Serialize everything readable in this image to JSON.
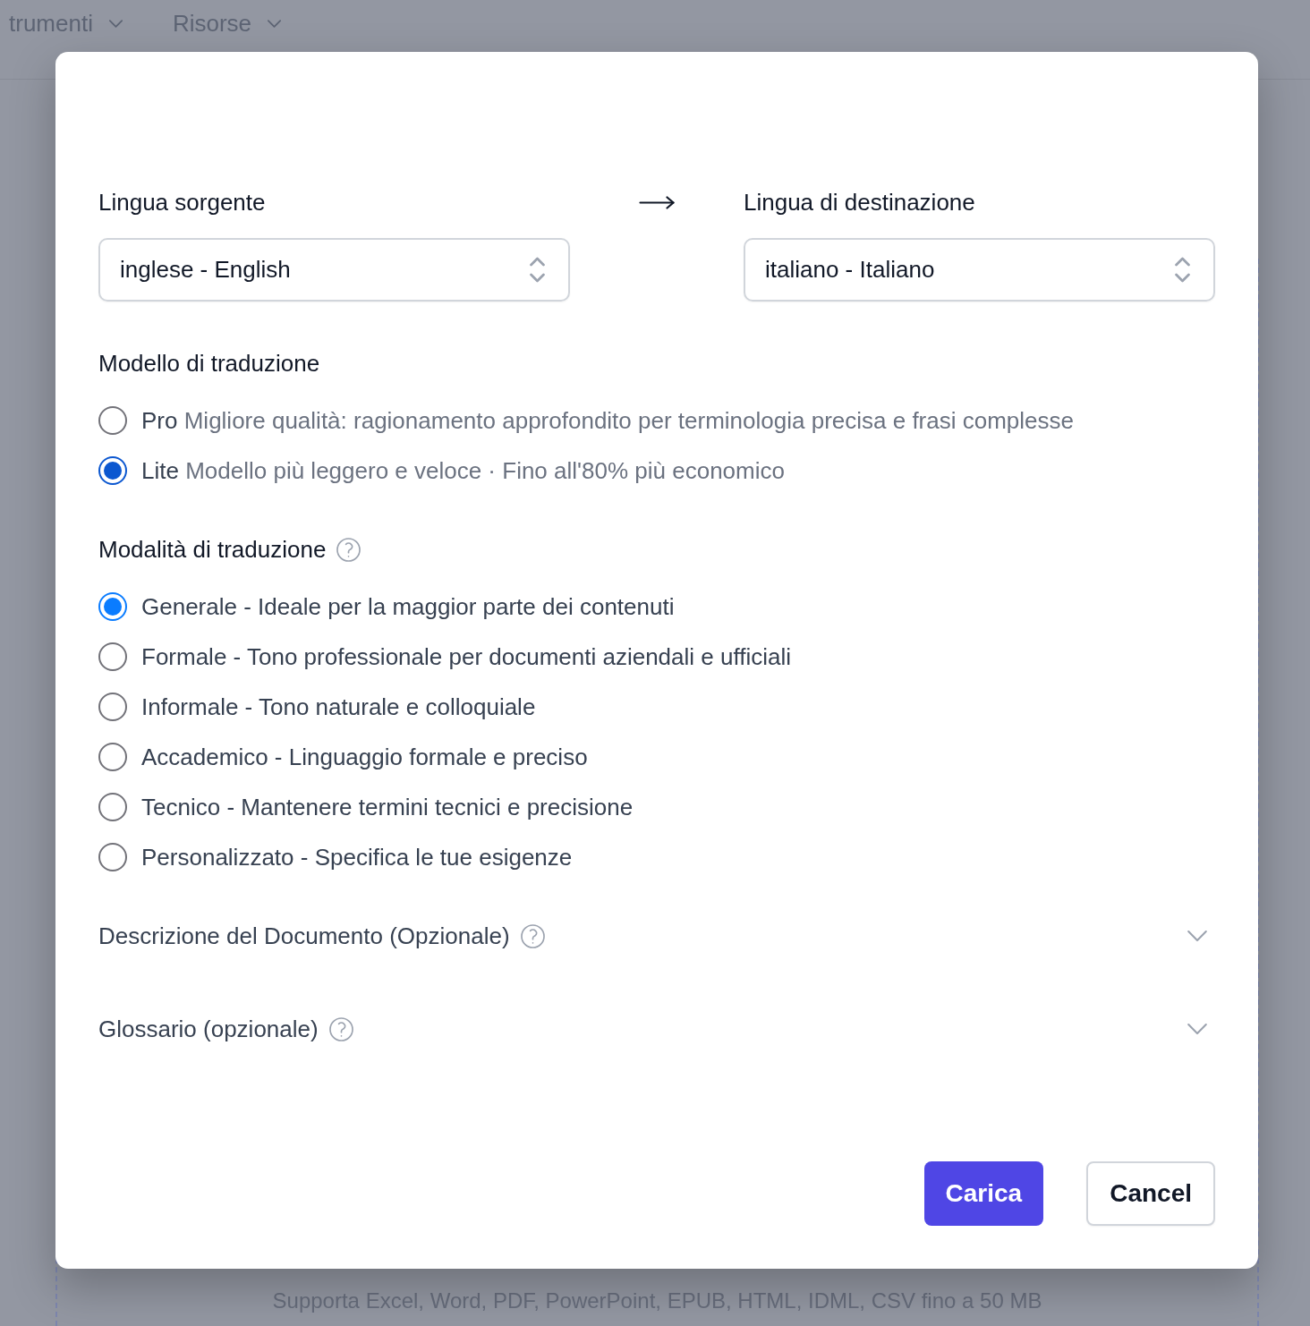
{
  "page": {
    "nav_items": [
      {
        "label": "trumenti"
      },
      {
        "label": "Risorse"
      }
    ],
    "upload_hint": "Supporta Excel, Word, PDF, PowerPoint, EPUB, HTML, IDML, CSV fino a 50 MB"
  },
  "dialog": {
    "source_language": {
      "label": "Lingua sorgente",
      "value": "inglese - English"
    },
    "target_language": {
      "label": "Lingua di destinazione",
      "value": "italiano - Italiano"
    },
    "model": {
      "title": "Modello di traduzione",
      "options": [
        {
          "name": "Pro",
          "description": "Migliore qualità: ragionamento approfondito per terminologia precisa e frasi complesse",
          "selected": false
        },
        {
          "name": "Lite",
          "description": "Modello più leggero e veloce · Fino all'80% più economico",
          "selected": true
        }
      ]
    },
    "mode": {
      "title": "Modalità di traduzione",
      "options": [
        {
          "label": "Generale - Ideale per la maggior parte dei contenuti",
          "selected": true
        },
        {
          "label": "Formale - Tono professionale per documenti aziendali e ufficiali",
          "selected": false
        },
        {
          "label": "Informale - Tono naturale e colloquiale",
          "selected": false
        },
        {
          "label": "Accademico - Linguaggio formale e preciso",
          "selected": false
        },
        {
          "label": "Tecnico - Mantenere termini tecnici e precisione",
          "selected": false
        },
        {
          "label": "Personalizzato - Specifica le tue esigenze",
          "selected": false
        }
      ]
    },
    "sections": [
      {
        "title": "Descrizione del Documento (Opzionale)",
        "expanded": false
      },
      {
        "title": "Glossario (opzionale)",
        "expanded": false
      }
    ],
    "buttons": [
      {
        "label": "Carica",
        "kind": "primary"
      },
      {
        "label": "Cancel",
        "kind": "secondary"
      }
    ]
  }
}
